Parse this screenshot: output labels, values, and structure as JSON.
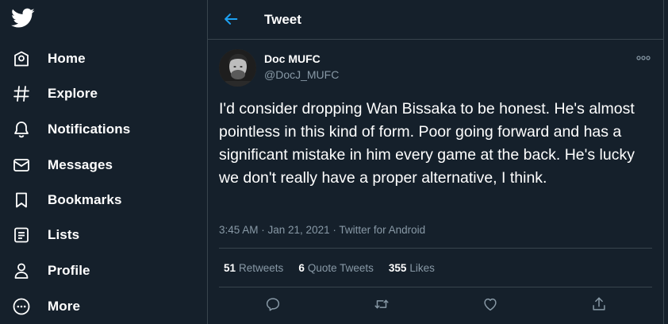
{
  "sidebar": {
    "logo_icon": "twitter-bird-icon",
    "items": [
      {
        "label": "Home",
        "icon": "home-icon"
      },
      {
        "label": "Explore",
        "icon": "hashtag-icon"
      },
      {
        "label": "Notifications",
        "icon": "bell-icon"
      },
      {
        "label": "Messages",
        "icon": "envelope-icon"
      },
      {
        "label": "Bookmarks",
        "icon": "bookmark-icon"
      },
      {
        "label": "Lists",
        "icon": "list-icon"
      },
      {
        "label": "Profile",
        "icon": "person-icon"
      },
      {
        "label": "More",
        "icon": "more-circle-icon"
      }
    ]
  },
  "header": {
    "title": "Tweet",
    "back_icon": "back-arrow-icon"
  },
  "tweet": {
    "author_name": "Doc MUFC",
    "author_handle": "@DocJ_MUFC",
    "text": "I'd consider dropping Wan Bissaka to be honest. He's almost pointless in this kind of form. Poor going forward and has a significant mistake in him every game at the back. He's lucky we don't really have a proper alternative, I think.",
    "time": "3:45 AM · Jan 21, 2021 · Twitter for Android",
    "stats": {
      "retweets_count": "51",
      "retweets_label": "Retweets",
      "quotes_count": "6",
      "quotes_label": "Quote Tweets",
      "likes_count": "355",
      "likes_label": "Likes"
    },
    "actions": [
      "reply-icon",
      "retweet-icon",
      "like-icon",
      "share-icon"
    ]
  },
  "colors": {
    "background": "#15202b",
    "border": "#38444d",
    "accent": "#1da1f2",
    "secondary_text": "#8899a6"
  }
}
